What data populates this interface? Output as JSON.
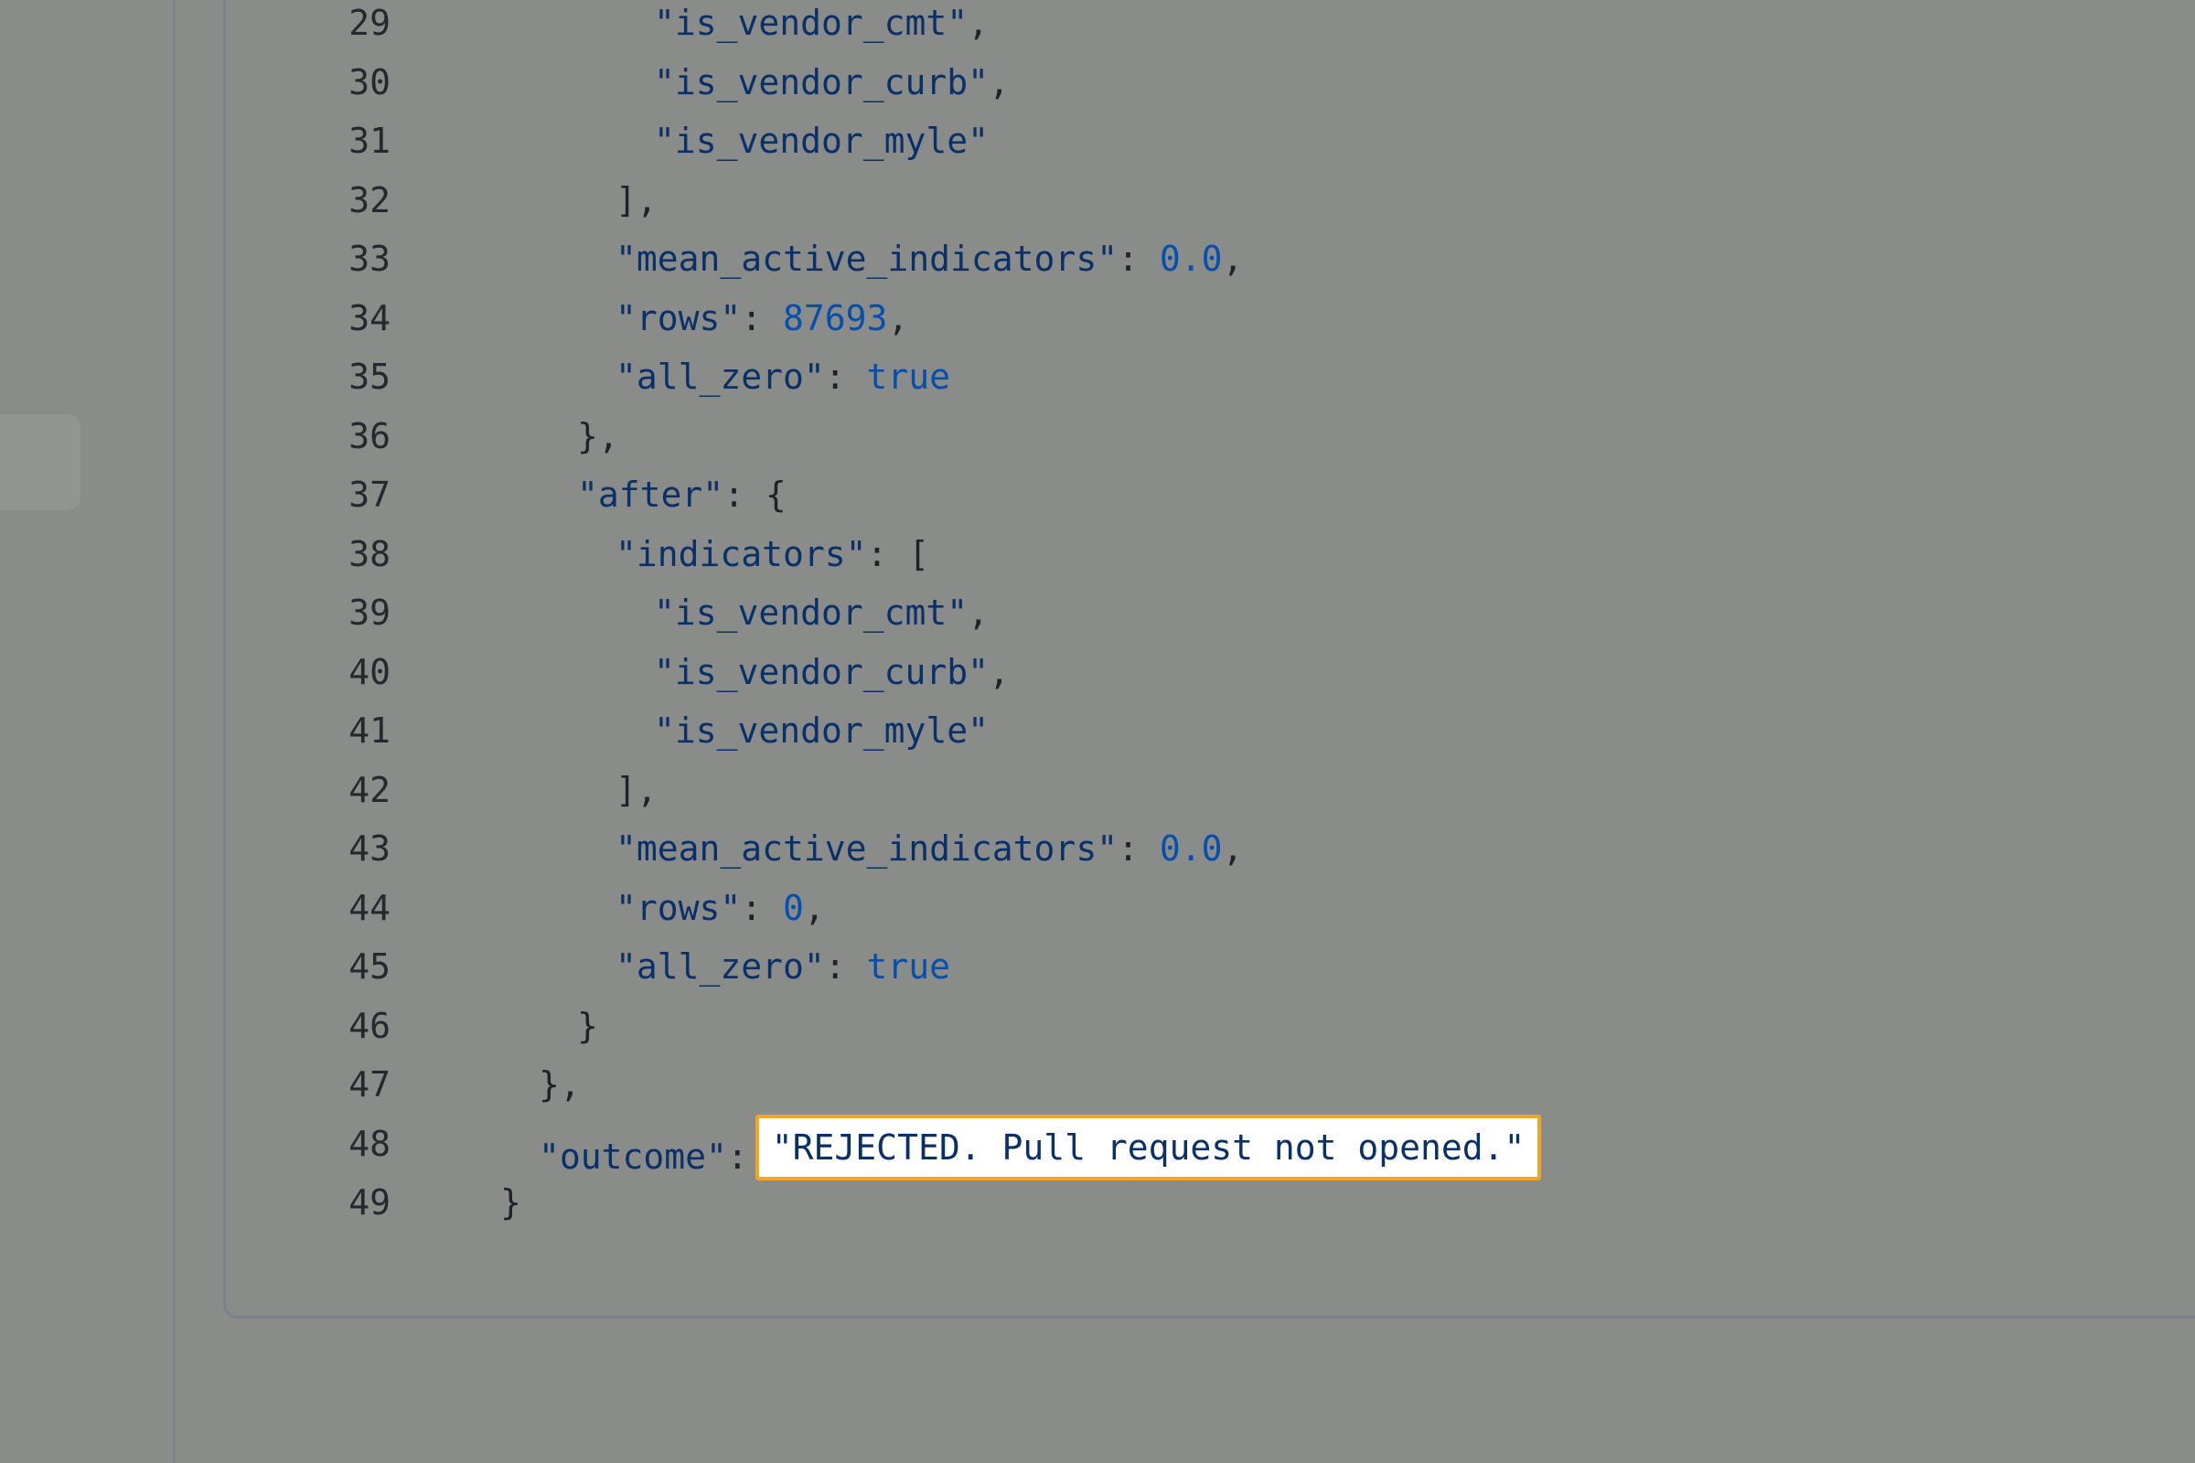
{
  "code": {
    "lines": [
      {
        "num": "29",
        "indent": 4,
        "parts": [
          {
            "t": "s",
            "v": "\"is_vendor_cmt\""
          },
          {
            "t": "p",
            "v": ","
          }
        ]
      },
      {
        "num": "30",
        "indent": 4,
        "parts": [
          {
            "t": "s",
            "v": "\"is_vendor_curb\""
          },
          {
            "t": "p",
            "v": ","
          }
        ]
      },
      {
        "num": "31",
        "indent": 4,
        "parts": [
          {
            "t": "s",
            "v": "\"is_vendor_myle\""
          }
        ]
      },
      {
        "num": "32",
        "indent": 3,
        "parts": [
          {
            "t": "p",
            "v": "],"
          }
        ]
      },
      {
        "num": "33",
        "indent": 3,
        "parts": [
          {
            "t": "k",
            "v": "\"mean_active_indicators\""
          },
          {
            "t": "p",
            "v": ": "
          },
          {
            "t": "n",
            "v": "0.0"
          },
          {
            "t": "p",
            "v": ","
          }
        ]
      },
      {
        "num": "34",
        "indent": 3,
        "parts": [
          {
            "t": "k",
            "v": "\"rows\""
          },
          {
            "t": "p",
            "v": ": "
          },
          {
            "t": "n",
            "v": "87693"
          },
          {
            "t": "p",
            "v": ","
          }
        ]
      },
      {
        "num": "35",
        "indent": 3,
        "parts": [
          {
            "t": "k",
            "v": "\"all_zero\""
          },
          {
            "t": "p",
            "v": ": "
          },
          {
            "t": "n",
            "v": "true"
          }
        ]
      },
      {
        "num": "36",
        "indent": 2,
        "parts": [
          {
            "t": "p",
            "v": "},"
          }
        ]
      },
      {
        "num": "37",
        "indent": 2,
        "parts": [
          {
            "t": "k",
            "v": "\"after\""
          },
          {
            "t": "p",
            "v": ": {"
          }
        ]
      },
      {
        "num": "38",
        "indent": 3,
        "parts": [
          {
            "t": "k",
            "v": "\"indicators\""
          },
          {
            "t": "p",
            "v": ": ["
          }
        ]
      },
      {
        "num": "39",
        "indent": 4,
        "parts": [
          {
            "t": "s",
            "v": "\"is_vendor_cmt\""
          },
          {
            "t": "p",
            "v": ","
          }
        ]
      },
      {
        "num": "40",
        "indent": 4,
        "parts": [
          {
            "t": "s",
            "v": "\"is_vendor_curb\""
          },
          {
            "t": "p",
            "v": ","
          }
        ]
      },
      {
        "num": "41",
        "indent": 4,
        "parts": [
          {
            "t": "s",
            "v": "\"is_vendor_myle\""
          }
        ]
      },
      {
        "num": "42",
        "indent": 3,
        "parts": [
          {
            "t": "p",
            "v": "],"
          }
        ]
      },
      {
        "num": "43",
        "indent": 3,
        "parts": [
          {
            "t": "k",
            "v": "\"mean_active_indicators\""
          },
          {
            "t": "p",
            "v": ": "
          },
          {
            "t": "n",
            "v": "0.0"
          },
          {
            "t": "p",
            "v": ","
          }
        ]
      },
      {
        "num": "44",
        "indent": 3,
        "parts": [
          {
            "t": "k",
            "v": "\"rows\""
          },
          {
            "t": "p",
            "v": ": "
          },
          {
            "t": "n",
            "v": "0"
          },
          {
            "t": "p",
            "v": ","
          }
        ]
      },
      {
        "num": "45",
        "indent": 3,
        "parts": [
          {
            "t": "k",
            "v": "\"all_zero\""
          },
          {
            "t": "p",
            "v": ": "
          },
          {
            "t": "n",
            "v": "true"
          }
        ]
      },
      {
        "num": "46",
        "indent": 2,
        "parts": [
          {
            "t": "p",
            "v": "}"
          }
        ]
      },
      {
        "num": "47",
        "indent": 1,
        "parts": [
          {
            "t": "p",
            "v": "},"
          }
        ]
      },
      {
        "num": "48",
        "indent": 1,
        "parts": [
          {
            "t": "k",
            "v": "\"outcome\""
          },
          {
            "t": "p",
            "v": ":"
          },
          {
            "t": "hl",
            "v": "\"REJECTED. Pull request not opened.\""
          }
        ]
      },
      {
        "num": "49",
        "indent": 0,
        "parts": [
          {
            "t": "p",
            "v": "}"
          }
        ]
      }
    ]
  },
  "colors": {
    "overlay_background": "#8a8c8a",
    "highlight_border": "#f0a726",
    "highlight_background": "#ffffff",
    "json_key": "#0a3069",
    "json_value": "#0550ae"
  }
}
